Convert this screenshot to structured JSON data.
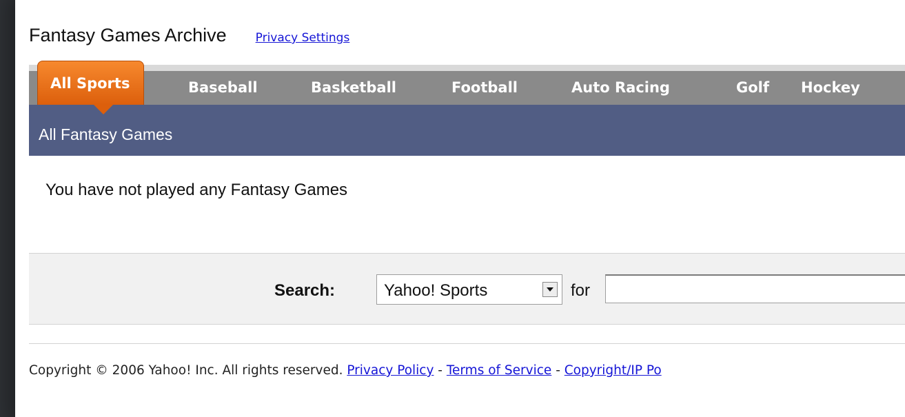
{
  "header": {
    "title": "Fantasy Games Archive",
    "privacy_link": "Privacy Settings"
  },
  "tabs": [
    {
      "label": "All Sports",
      "active": true
    },
    {
      "label": "Baseball",
      "active": false
    },
    {
      "label": "Basketball",
      "active": false
    },
    {
      "label": "Football",
      "active": false
    },
    {
      "label": "Auto Racing",
      "active": false
    },
    {
      "label": "Golf",
      "active": false
    },
    {
      "label": "Hockey",
      "active": false
    }
  ],
  "section": {
    "title": "All Fantasy Games",
    "empty_message": "You have not played any Fantasy Games"
  },
  "search": {
    "label": "Search:",
    "selected_source": "Yahoo! Sports",
    "for_label": "for",
    "query": ""
  },
  "footer": {
    "copyright": "Copyright © 2006 Yahoo! Inc. All rights reserved.",
    "separator": " - ",
    "links": [
      "Privacy Policy",
      "Terms of Service",
      "Copyright/IP Po"
    ]
  },
  "colors": {
    "active_tab": "#f7892e",
    "tab_strip": "#8a8a8a",
    "section_bar": "#515d84",
    "link": "#1515d6"
  }
}
